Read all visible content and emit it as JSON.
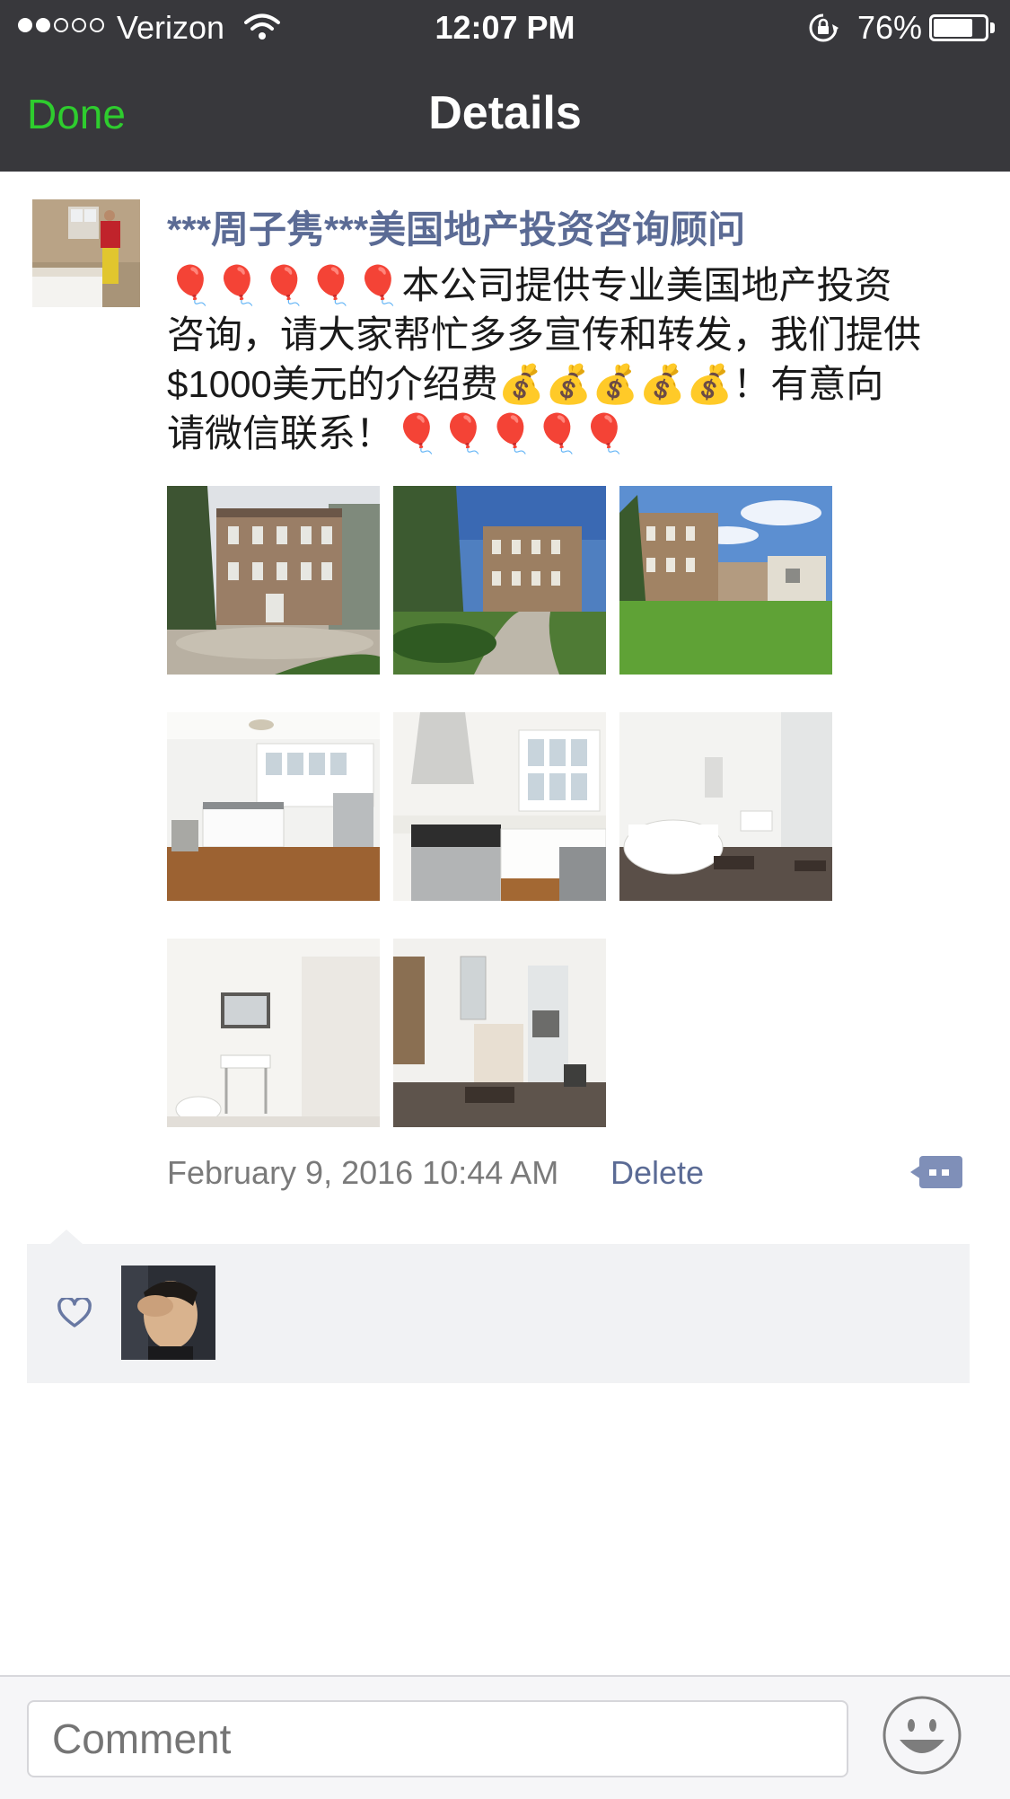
{
  "status_bar": {
    "carrier": "Verizon",
    "time": "12:07 PM",
    "battery": "76%",
    "battery_level": 0.76,
    "signal_bars": 2,
    "signal_total": 5
  },
  "nav": {
    "done_label": "Done",
    "title": "Details"
  },
  "post": {
    "author": "***周子隽***美国地产投资咨询顾问",
    "text_line1": "🎈🎈🎈🎈🎈本公司提供专业美国地产投资",
    "text_line2": "咨询，请大家帮忙多多宣传和转发，我们提供",
    "text_line3": "$1000美元的介绍费💰💰💰💰💰！有意向",
    "text_line4": "请微信联系！🎈🎈🎈🎈🎈",
    "photos": [
      "house-exterior-front",
      "house-exterior-driveway",
      "house-exterior-lawn",
      "kitchen-island",
      "kitchen-range",
      "bathroom-tub",
      "bathroom-sink",
      "bathroom-shower"
    ],
    "timestamp": "February 9, 2016 10:44 AM",
    "delete_label": "Delete"
  },
  "likes": {
    "icon": "heart-icon"
  },
  "comment_bar": {
    "placeholder": "Comment",
    "emoji_icon": "smiley-icon"
  },
  "colors": {
    "nav_bg": "#38383c",
    "done_green": "#2ecc2e",
    "link_blue": "#5b6b95",
    "likes_bg": "#f1f2f4"
  }
}
